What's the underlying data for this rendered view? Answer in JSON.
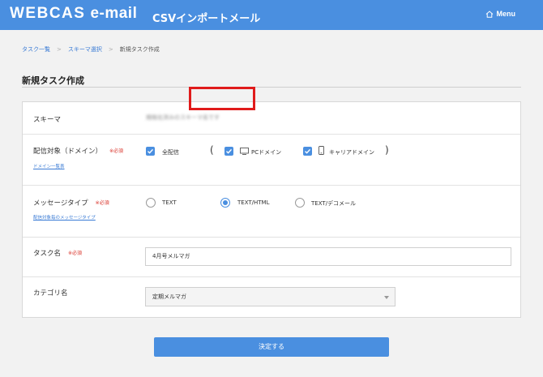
{
  "header": {
    "logo_main": "WEBCAS",
    "logo_sub": "e-mail",
    "app_title": "CSVインポートメール",
    "menu_label": "Menu",
    "menu_icon": "home-icon"
  },
  "breadcrumb": {
    "items": [
      "タスク一覧",
      "スキーマ選択",
      "新規タスク作成"
    ],
    "separator": ">"
  },
  "page": {
    "title": "新規タスク作成"
  },
  "form": {
    "schema": {
      "label": "スキーマ",
      "value": "規格化済みのスキーマ名です"
    },
    "domain": {
      "label": "配信対象（ドメイン）",
      "required": "※必須",
      "link": "ドメイン一覧表",
      "open_paren": "(",
      "close_paren": ")",
      "options": [
        {
          "label": "全配信",
          "checked": true,
          "icon": ""
        },
        {
          "label": "PCドメイン",
          "checked": true,
          "icon": "monitor-icon"
        },
        {
          "label": "キャリアドメイン",
          "checked": true,
          "icon": "mobile-phone-icon"
        }
      ]
    },
    "message_type": {
      "label": "メッセージタイプ",
      "required": "※必須",
      "link": "配信対象毎のメッセージタイプ",
      "options": [
        {
          "label": "TEXT",
          "selected": false
        },
        {
          "label": "TEXT/HTML",
          "selected": true
        },
        {
          "label": "TEXT/デコメール",
          "selected": false
        }
      ],
      "highlight_color": "#e01b1b"
    },
    "task_name": {
      "label": "タスク名",
      "required": "※必須",
      "value": "4月号メルマガ"
    },
    "category": {
      "label": "カテゴリ名",
      "value": "定期メルマガ"
    }
  },
  "submit_label": "決定する",
  "colors": {
    "accent": "#4a8fe0",
    "required": "#d9342b",
    "link": "#3a7bd5"
  }
}
